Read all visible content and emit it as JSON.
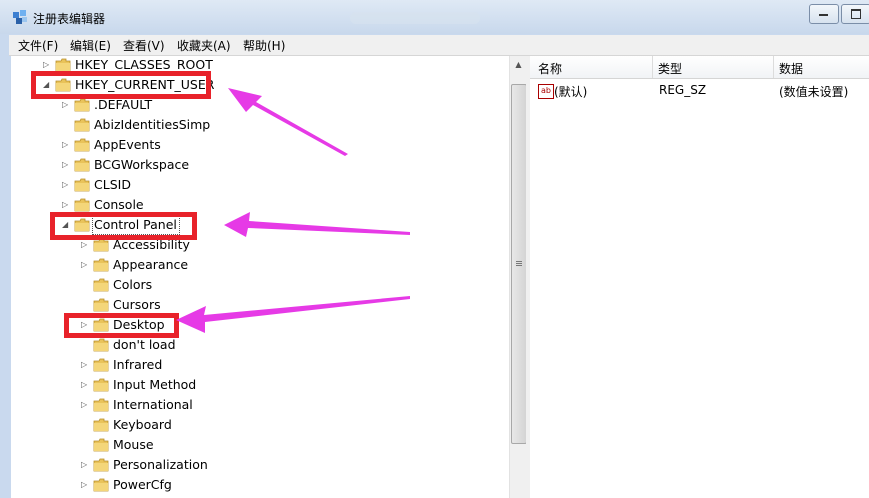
{
  "window": {
    "title": "注册表编辑器"
  },
  "menu": [
    "文件(F)",
    "编辑(E)",
    "查看(V)",
    "收藏夹(A)",
    "帮助(H)"
  ],
  "tree": [
    {
      "label": "HKEY_CLASSES_ROOT",
      "depth": 0,
      "expander": "collapsed"
    },
    {
      "label": "HKEY_CURRENT_USER",
      "depth": 0,
      "expander": "expanded"
    },
    {
      "label": ".DEFAULT",
      "depth": 1,
      "expander": "collapsed"
    },
    {
      "label": "AbizIdentitiesSimp",
      "depth": 1,
      "expander": "none"
    },
    {
      "label": "AppEvents",
      "depth": 1,
      "expander": "collapsed"
    },
    {
      "label": "BCGWorkspace",
      "depth": 1,
      "expander": "collapsed"
    },
    {
      "label": "CLSID",
      "depth": 1,
      "expander": "collapsed"
    },
    {
      "label": "Console",
      "depth": 1,
      "expander": "collapsed"
    },
    {
      "label": "Control Panel",
      "depth": 1,
      "expander": "expanded"
    },
    {
      "label": "Accessibility",
      "depth": 2,
      "expander": "collapsed"
    },
    {
      "label": "Appearance",
      "depth": 2,
      "expander": "collapsed"
    },
    {
      "label": "Colors",
      "depth": 2,
      "expander": "none"
    },
    {
      "label": "Cursors",
      "depth": 2,
      "expander": "none"
    },
    {
      "label": "Desktop",
      "depth": 2,
      "expander": "collapsed"
    },
    {
      "label": "don't load",
      "depth": 2,
      "expander": "none"
    },
    {
      "label": "Infrared",
      "depth": 2,
      "expander": "collapsed"
    },
    {
      "label": "Input Method",
      "depth": 2,
      "expander": "collapsed"
    },
    {
      "label": "International",
      "depth": 2,
      "expander": "collapsed"
    },
    {
      "label": "Keyboard",
      "depth": 2,
      "expander": "none"
    },
    {
      "label": "Mouse",
      "depth": 2,
      "expander": "none"
    },
    {
      "label": "Personalization",
      "depth": 2,
      "expander": "collapsed"
    },
    {
      "label": "PowerCfg",
      "depth": 2,
      "expander": "collapsed"
    }
  ],
  "list": {
    "headers": [
      "名称",
      "类型",
      "数据"
    ],
    "rows": [
      {
        "name": "(默认)",
        "type": "REG_SZ",
        "data": "(数值未设置)",
        "icon": "ab-string-icon"
      }
    ]
  },
  "annotations": {
    "highlight_color": "#e8222a",
    "arrow_color": "#e63ae6"
  }
}
